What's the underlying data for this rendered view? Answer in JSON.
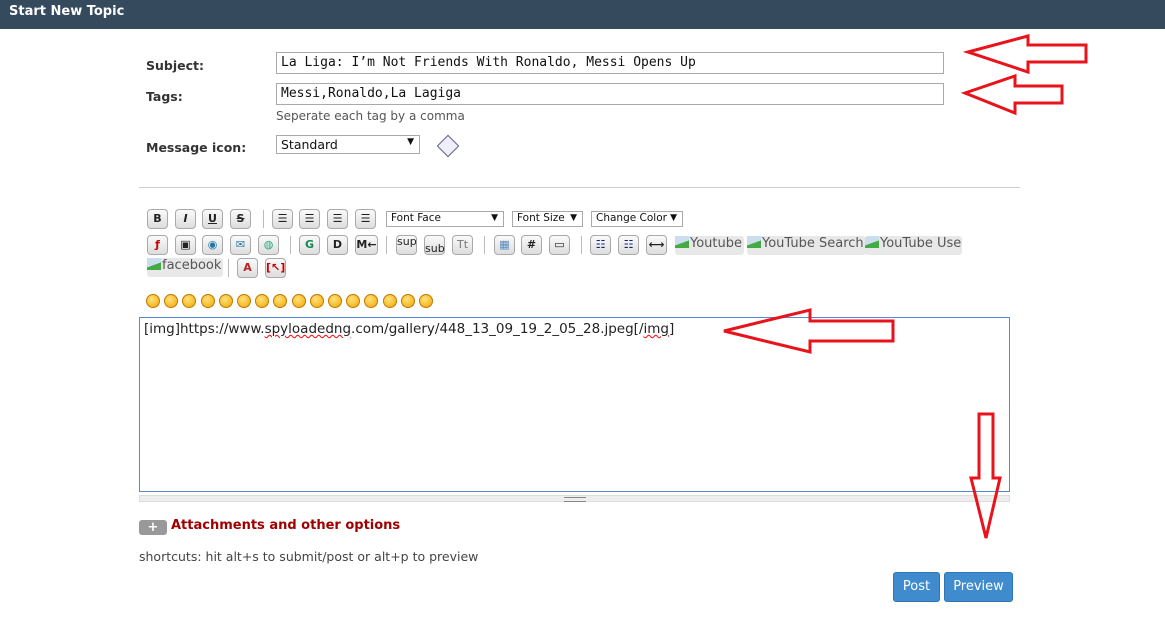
{
  "header": {
    "title": "Start New Topic"
  },
  "form": {
    "subject_label": "Subject:",
    "subject_value": "La Liga: I’m Not Friends With Ronaldo, Messi Opens Up",
    "tags_label": "Tags:",
    "tags_value": "Messi,Ronaldo,La Lagiga",
    "tags_hint": "Seperate each tag by a comma",
    "icon_label": "Message icon:",
    "icon_value": "Standard"
  },
  "toolbar": {
    "row1": [
      "B",
      "I",
      "U",
      "S"
    ],
    "font_face": "Font Face",
    "font_size": "Font Size",
    "change_color": "Change Color",
    "sup": "sup",
    "sub": "sub",
    "tt": "Tt",
    "hash": "#",
    "g": "G",
    "d": "D",
    "m": "M←",
    "broken": [
      "Youtube",
      "YouTube Search",
      "YouTube User",
      "facebook"
    ],
    "smiley_count": 16
  },
  "message": {
    "pre": "[img]https://www.",
    "sp": "spyloadedng",
    "post": ".com/gallery/448_13_09_19_2_05_28.jpeg[/",
    "sp2": "img",
    "end": "]"
  },
  "attachments": {
    "plus": "+",
    "label": "Attachments and other options"
  },
  "shortcuts": "shortcuts: hit alt+s to submit/post or alt+p to preview",
  "buttons": {
    "post": "Post",
    "preview": "Preview"
  },
  "colors": {
    "header": "#364a5e",
    "button": "#3f8bcd",
    "annotation": "#e8131b",
    "link": "#a00000"
  }
}
